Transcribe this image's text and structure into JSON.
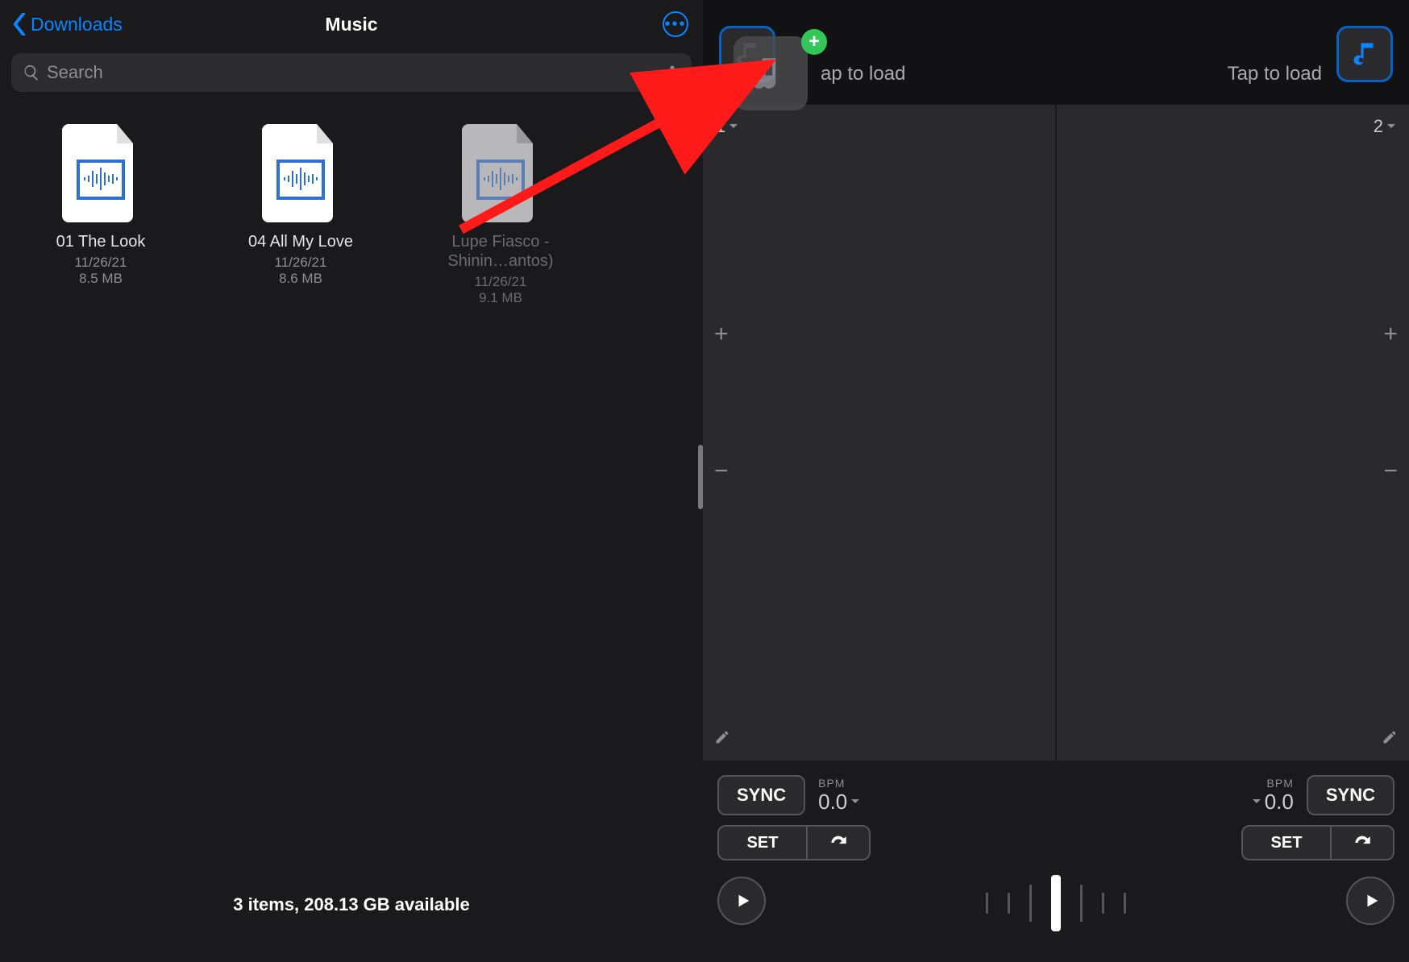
{
  "left": {
    "back_label": "Downloads",
    "title": "Music",
    "search_placeholder": "Search",
    "files": [
      {
        "name": "01 The Look",
        "date": "11/26/21",
        "size": "8.5 MB"
      },
      {
        "name": "04 All My Love",
        "date": "11/26/21",
        "size": "8.6 MB"
      },
      {
        "name": "Lupe Fiasco - Shinin…antos)",
        "date": "11/26/21",
        "size": "9.1 MB"
      }
    ],
    "footer": "3 items, 208.13 GB available"
  },
  "right": {
    "tap_label_a": "ap to load",
    "tap_label_b": "Tap to load",
    "deck_a_num": "1",
    "deck_b_num": "2",
    "sync_label": "SYNC",
    "bpm_label": "BPM",
    "bpm_value": "0.0",
    "set_label": "SET",
    "plus": "+",
    "minus": "−"
  }
}
